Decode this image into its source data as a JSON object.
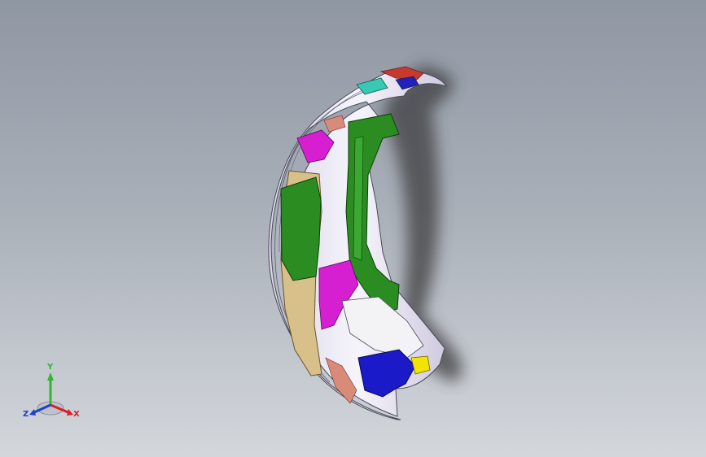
{
  "viewport": {
    "background_top": "#8f97a3",
    "background_bottom": "#d3d7dc"
  },
  "triad": {
    "x_label": "X",
    "y_label": "Y",
    "z_label": "Z",
    "x_color": "#d8202a",
    "y_color": "#2fb82f",
    "z_color": "#1f3fd0"
  },
  "model": {
    "name_icon": "car-front-bumper-assembly",
    "colors": {
      "shell": "#ece9f3",
      "green_part": "#2b8c22",
      "beige_part": "#d8c08a",
      "magenta_part": "#d51fd0",
      "blue_part": "#1a1ac8",
      "yellow_part": "#f2e400",
      "red_part": "#c83a2e",
      "teal_part": "#38c9b2",
      "salmon_part": "#d98b7a",
      "shadow": "#3d3d40"
    }
  }
}
